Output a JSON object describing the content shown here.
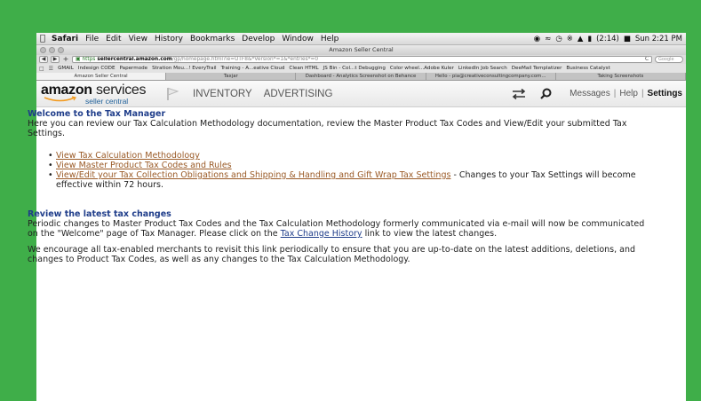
{
  "menubar": {
    "app": "Safari",
    "items": [
      "File",
      "Edit",
      "View",
      "History",
      "Bookmarks",
      "Develop",
      "Window",
      "Help"
    ],
    "battery": "(2:14)",
    "clock": "Sun 2:21 PM"
  },
  "window": {
    "title": "Amazon Seller Central"
  },
  "address": {
    "https": "https",
    "host": "sellercentral.amazon.com",
    "path": "/gp/homepage.html?ie=UTF8&*Version*=1&*entries*=0",
    "reload": "C",
    "search_placeholder": "Google"
  },
  "bookmarks": [
    "GMAIL",
    "Indesign CODE",
    "Papermode",
    "Stration Mou...! EveryTrail",
    "Training - A...eative Cloud",
    "Clean HTML",
    "JS Bin - Col...t Debugging",
    "Color wheel...Adobe Kuler",
    "LinkedIn Job Search",
    "DeeMail Templatizer",
    "Business Catalyst"
  ],
  "tabs": [
    {
      "label": "Amazon Seller Central",
      "active": true
    },
    {
      "label": "Taxjar",
      "active": false
    },
    {
      "label": "Dashboard - Analytics Screenshot on Behance",
      "active": false
    },
    {
      "label": "Hello - pia@creativeconsultingcompany.com...",
      "active": false
    },
    {
      "label": "Taking Screenshots",
      "active": false
    }
  ],
  "header": {
    "logo_main": "amazon",
    "logo_services": "services",
    "logo_sub": "seller central",
    "nav": [
      "INVENTORY",
      "ADVERTISING"
    ],
    "messages": "Messages",
    "help": "Help",
    "settings": "Settings",
    "sep": "|"
  },
  "content": {
    "welcome_title": "Welcome to the Tax Manager",
    "welcome_text": "Here you can review our Tax Calculation Methodology documentation, review the Master Product Tax Codes and View/Edit your submitted Tax Settings.",
    "links": [
      "View Tax Calculation Methodology",
      "View Master Product Tax Codes and Rules",
      "View/Edit your Tax Collection Obligations and Shipping & Handling and Gift Wrap Tax Settings"
    ],
    "link3_suffix": " - Changes to your Tax Settings will become effective within 72 hours.",
    "review_title": "Review the latest tax changes",
    "review_text_a": "Periodic changes to Master Product Tax Codes and the Tax Calculation Methodology formerly communicated via e-mail will now be communicated on the \"Welcome\" page of Tax Manager. Please click on the ",
    "review_link": "Tax Change History",
    "review_text_b": " link to view the latest changes.",
    "encourage_text": "We encourage all tax-enabled merchants to revisit this link periodically to ensure that you are up-to-date on the latest additions, deletions, and changes to Product Tax Codes, as well as any changes to the Tax Calculation Methodology."
  }
}
